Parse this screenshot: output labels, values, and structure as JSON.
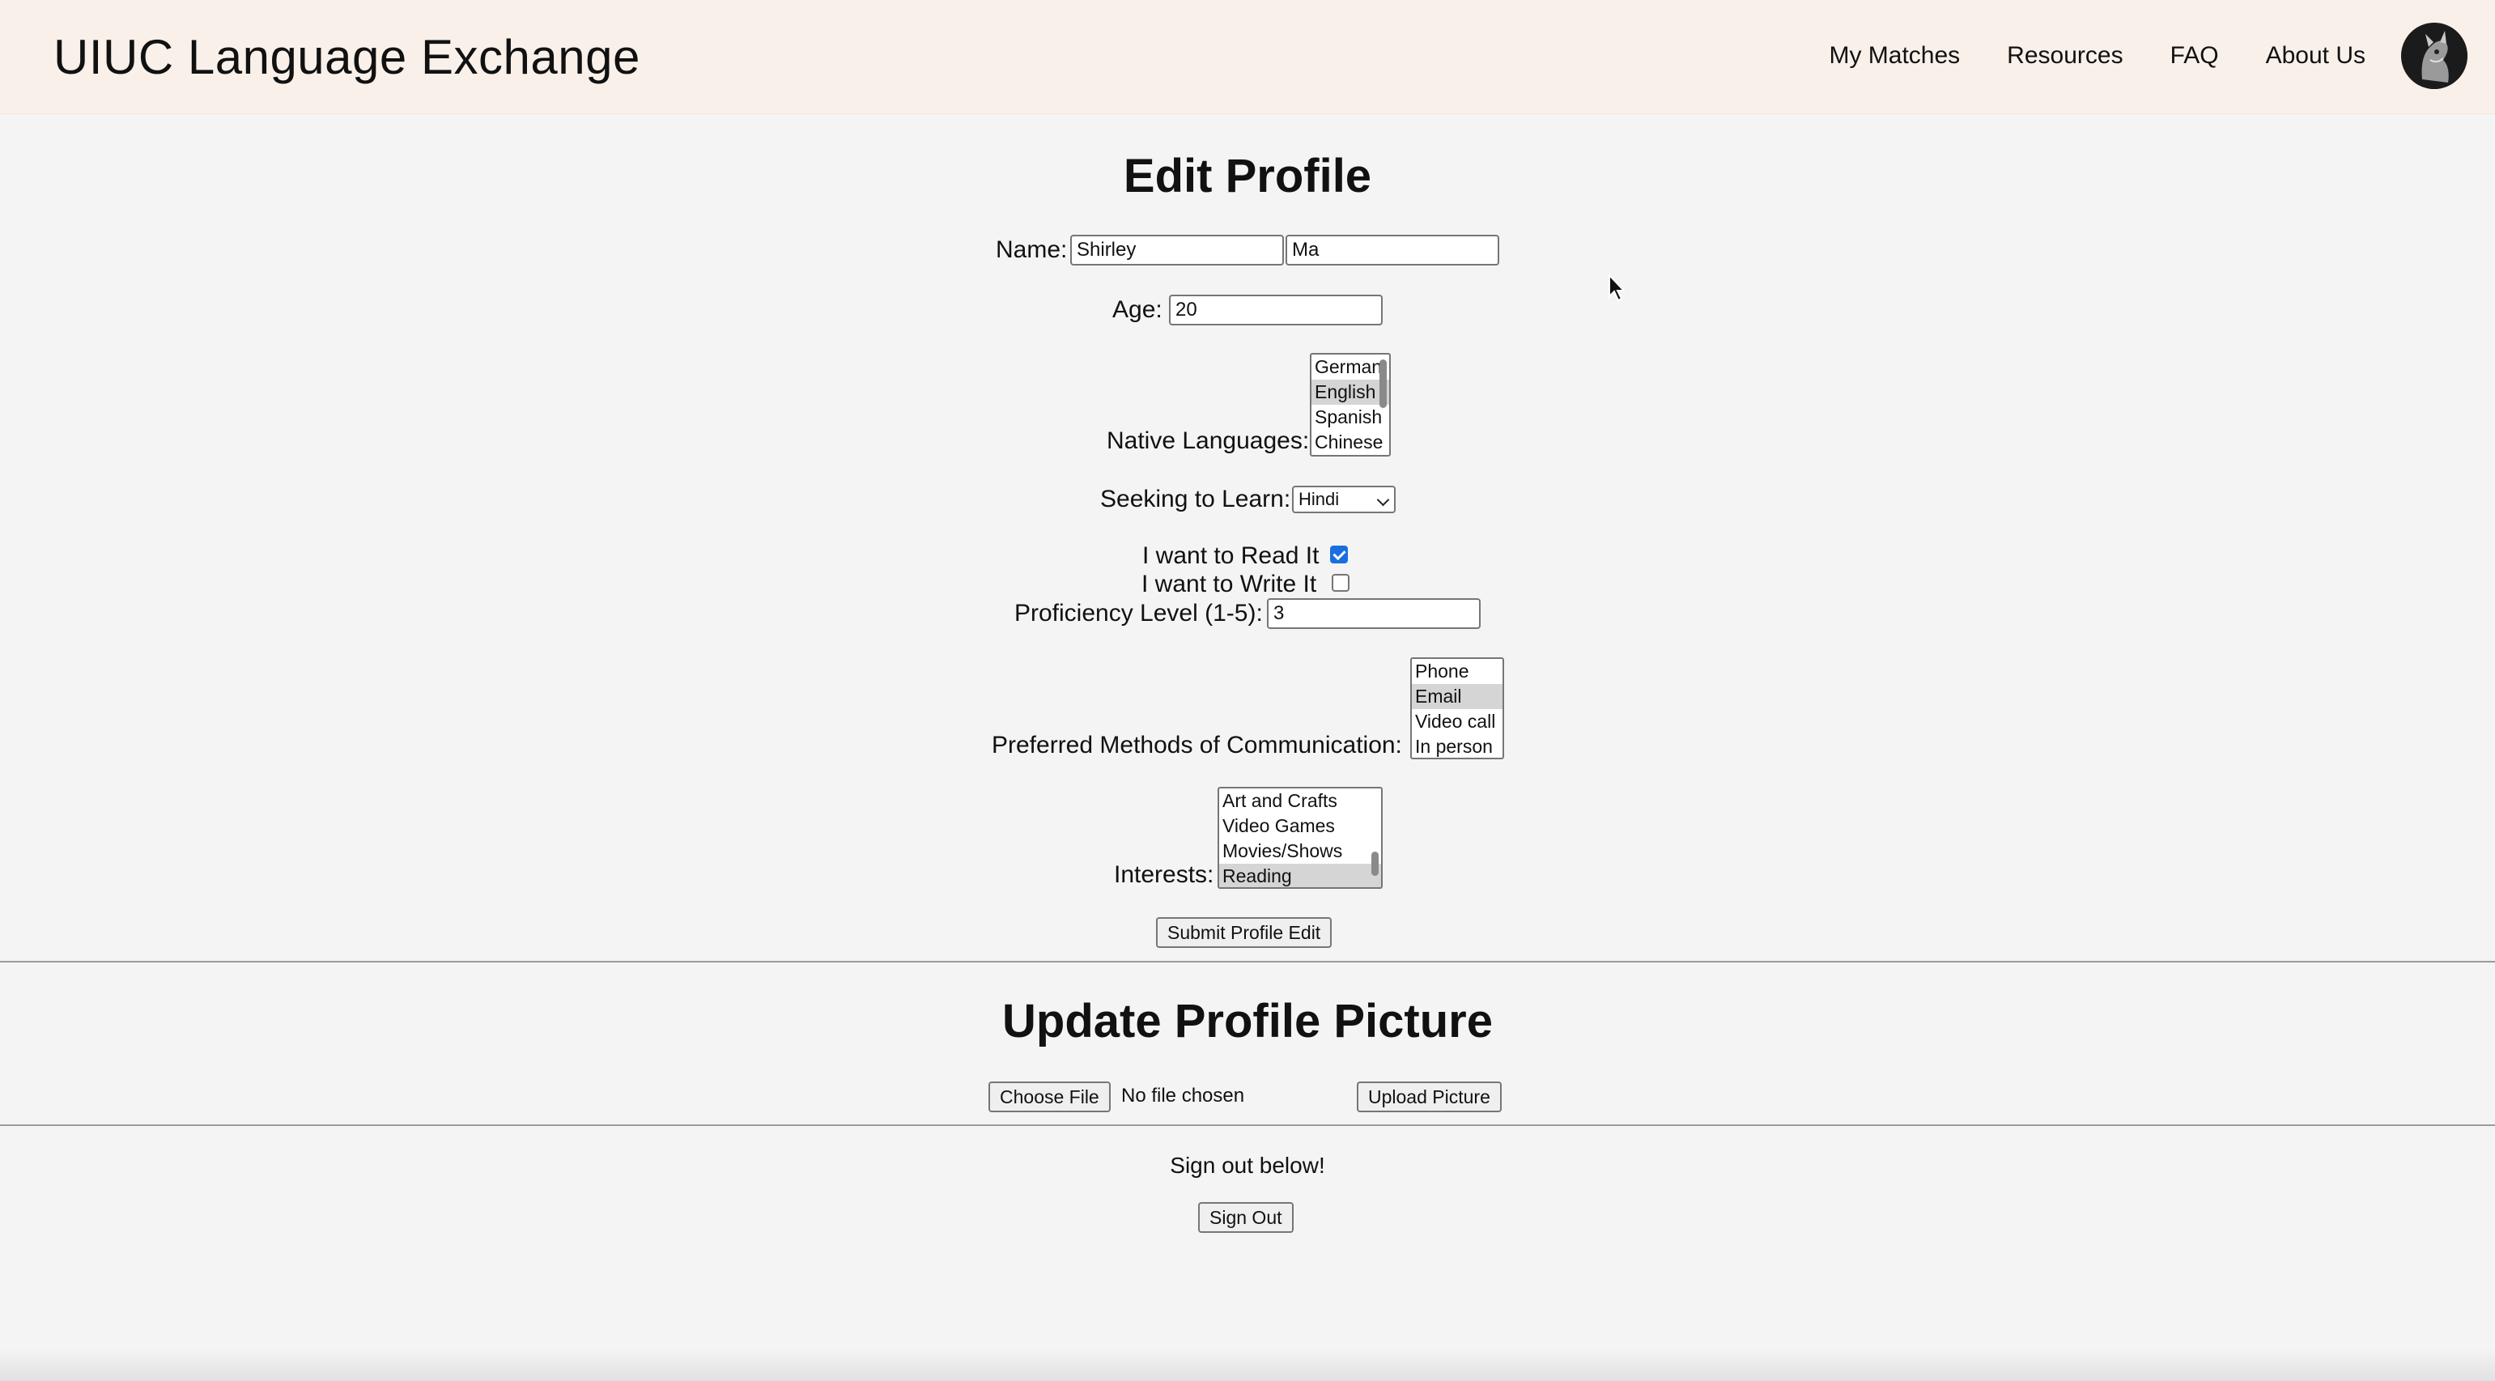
{
  "header": {
    "brand": "UIUC Language Exchange",
    "nav": [
      "My Matches",
      "Resources",
      "FAQ",
      "About Us"
    ]
  },
  "edit_profile": {
    "title": "Edit Profile",
    "name_label": "Name:",
    "first_name": "Shirley",
    "last_name": "Ma",
    "age_label": "Age:",
    "age": "20",
    "native_label": "Native Languages:",
    "native_options": [
      "German",
      "English",
      "Spanish",
      "Chinese"
    ],
    "native_selected": "English",
    "seeking_label": "Seeking to Learn:",
    "seeking_value": "Hindi",
    "read_label": "I want to Read It",
    "read_checked": true,
    "write_label": "I want to Write It",
    "write_checked": false,
    "proficiency_label": "Proficiency Level (1-5):",
    "proficiency": "3",
    "comm_label": "Preferred Methods of Communication:",
    "comm_options": [
      "Phone",
      "Email",
      "Video call",
      "In person"
    ],
    "comm_selected": "Email",
    "interests_label": "Interests:",
    "interests_options": [
      "Art and Crafts",
      "Video Games",
      "Movies/Shows",
      "Reading"
    ],
    "interests_selected": "Reading",
    "submit_label": "Submit Profile Edit"
  },
  "upload": {
    "title": "Update Profile Picture",
    "choose_label": "Choose File",
    "file_status": "No file chosen",
    "upload_label": "Upload Picture"
  },
  "signout": {
    "prompt": "Sign out below!",
    "button_label": "Sign Out"
  },
  "colors": {
    "header_bg": "#f9f0ea",
    "page_bg": "#f4f4f4",
    "checkbox_accent": "#1a6fe0"
  }
}
